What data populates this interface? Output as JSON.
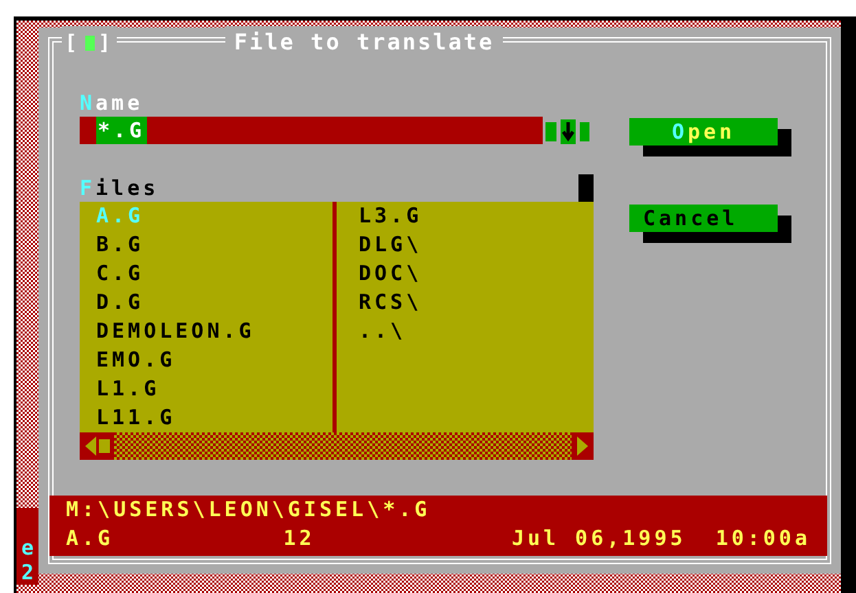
{
  "dialog": {
    "close_box": {
      "left": "[",
      "right": "]"
    },
    "title": "File to translate"
  },
  "name_field": {
    "label": {
      "hotkey": "N",
      "rest": "ame",
      "focused": true
    },
    "value": "*.G",
    "value_selected": true
  },
  "files": {
    "label": {
      "hotkey": "F",
      "rest": "iles",
      "focused": false
    },
    "columns": [
      [
        {
          "name": "A.G",
          "selected": true
        },
        {
          "name": "B.G",
          "selected": false
        },
        {
          "name": "C.G",
          "selected": false
        },
        {
          "name": "D.G",
          "selected": false
        },
        {
          "name": "DEMOLEON.G",
          "selected": false
        },
        {
          "name": "EMO.G",
          "selected": false
        },
        {
          "name": "L1.G",
          "selected": false
        },
        {
          "name": "L11.G",
          "selected": false
        }
      ],
      [
        {
          "name": "L3.G",
          "selected": false
        },
        {
          "name": "DLG\\",
          "selected": false
        },
        {
          "name": "DOC\\",
          "selected": false
        },
        {
          "name": "RCS\\",
          "selected": false
        },
        {
          "name": "..\\",
          "selected": false
        }
      ]
    ]
  },
  "buttons": [
    {
      "label": "Open",
      "default": true
    },
    {
      "label": "Cancel",
      "default": false
    }
  ],
  "info": {
    "path": "M:\\USERS\\LEON\\GISEL\\*.G",
    "file": "A.G",
    "size": "12",
    "date": "Jul 06,1995",
    "time": "10:00a"
  },
  "background_fragments": [
    "e",
    "2"
  ]
}
